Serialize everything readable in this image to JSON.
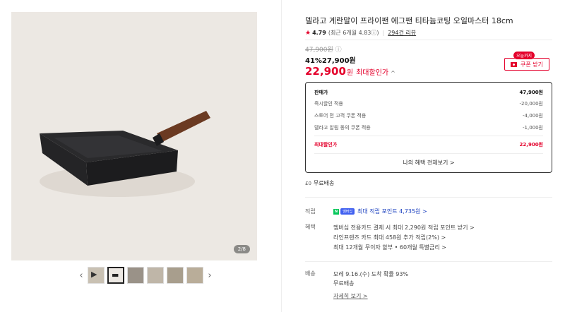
{
  "gallery": {
    "counter": "2/8",
    "prev_icon": "chevron-left-icon",
    "next_icon": "chevron-right-icon",
    "thumb_count": 6
  },
  "product": {
    "title": "델라고 계란말이 프라이팬 에그팬 티타늄코팅 오일마스터 18cm",
    "rating": "4.79",
    "rating_detail": "(최근 6개월 4.83ⓘ)",
    "reviews": "294건 리뷰"
  },
  "price": {
    "original": "47,900원",
    "original_info_icon": "ⓘ",
    "sale_line": "41%27,900원",
    "max_value": "22,900",
    "max_unit": "원",
    "max_label": "최대할인가",
    "max_chevron": "^"
  },
  "coupon": {
    "badge": "오늘까지",
    "button": "쿠폰 받기"
  },
  "breakdown": {
    "rows": [
      {
        "label": "판매가",
        "value": "47,900원"
      },
      {
        "label": "즉시할인 적용",
        "value": "-20,000원"
      },
      {
        "label": "스토어 전 고객 쿠폰 적용",
        "value": "-4,000원"
      },
      {
        "label": "델라고 알림 동의 쿠폰 적용",
        "value": "-1,000원"
      }
    ],
    "total_label": "최대할인가",
    "total_value": "22,900원",
    "benefit_button": "나의 혜택 전체보기 >"
  },
  "shipping_badge": {
    "icon": "truck-icon",
    "icon_text": "£0",
    "text": "무료배송"
  },
  "points": {
    "label": "적립",
    "npay": "N",
    "membership": "멤버십",
    "text": "최대 적립 포인트 4,735원 >"
  },
  "benefits": {
    "label": "혜택",
    "items": [
      "멤버십 전용카드 결제 시 최대 2,290원 적립 포인트 받기 >",
      "라인프렌즈 카드 최대 458원 추가 적립(2%) >",
      "최대 12개월 무이자 할부 • 60개월 특별금리 >"
    ]
  },
  "delivery": {
    "label": "배송",
    "eta": "모레 9.16.(수) 도착 확률 93%",
    "fee": "무료배송",
    "detail_link": "자세히 보기 >"
  }
}
